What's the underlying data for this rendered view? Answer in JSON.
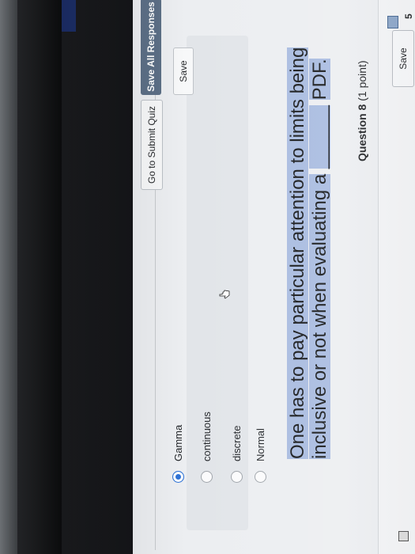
{
  "header": {
    "save_label": "Save",
    "question_number": "5",
    "question_title": "Question 8",
    "question_points": "(1 point)"
  },
  "question": {
    "text": "One has to pay particular attention to limits being inclusive or not when evaluating a",
    "blank": "______",
    "tail": "PDF."
  },
  "options": [
    {
      "label": "Normal",
      "selected": false
    },
    {
      "label": "discrete",
      "selected": false
    },
    {
      "label": "continuous",
      "selected": false
    },
    {
      "label": "Gamma",
      "selected": true
    }
  ],
  "actions": {
    "save_label": "Save",
    "save_all_label": "Save All Responses",
    "submit_label": "Go to Submit Quiz"
  },
  "colors": {
    "accent": "#2f73d6",
    "primary_button": "#5c6f86",
    "highlight": "#a8bbe0"
  },
  "icons": {
    "question_flag": "flag-icon",
    "cursor": "hand-pointer-icon"
  }
}
